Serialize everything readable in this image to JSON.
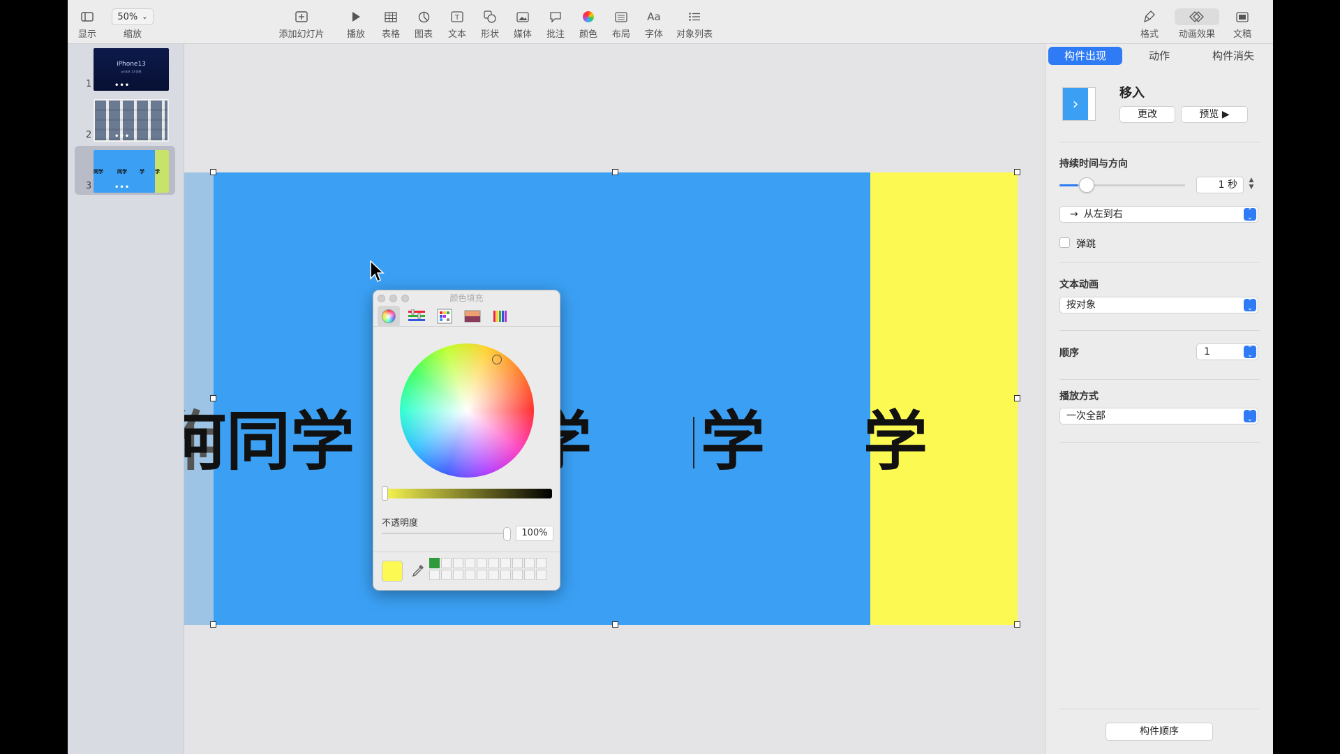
{
  "toolbar": {
    "view_label": "显示",
    "zoom_value": "50%",
    "zoom_label": "缩放",
    "add_slide_label": "添加幻灯片",
    "play_label": "播放",
    "table_label": "表格",
    "chart_label": "图表",
    "text_label": "文本",
    "shape_label": "形状",
    "media_label": "媒体",
    "comment_label": "批注",
    "color_label": "颜色",
    "layout_label": "布局",
    "font_label": "字体",
    "font_icon_text": "Aa",
    "object_list_label": "对象列表",
    "format_label": "格式",
    "animate_label": "动画效果",
    "document_label": "文稿"
  },
  "navigator": {
    "slides": [
      {
        "number": "1",
        "title": "iPhone13",
        "subtitle": "pocket 13 强悍"
      },
      {
        "number": "2"
      },
      {
        "number": "3",
        "texts": [
          "同学",
          "同学",
          "学",
          "学"
        ],
        "selected": true
      }
    ]
  },
  "slide": {
    "text_1": "何同学",
    "text_2": "何同学",
    "text_3": "学",
    "text_4": "学",
    "bg_color": "#3ba0f4",
    "rect_color": "#fbf952"
  },
  "color_panel": {
    "title": "颜色填充",
    "opacity_label": "不透明度",
    "opacity_value": "100%",
    "current_color": "#fbf952",
    "modes": [
      "color-wheel-icon",
      "sliders-icon",
      "palettes-icon",
      "image-palette-icon",
      "pencils-icon"
    ]
  },
  "inspector": {
    "tabs": [
      "构件出现",
      "动作",
      "构件消失"
    ],
    "active_tab": "构件出现",
    "effect_name": "移入",
    "change_button": "更改",
    "preview_button": "预览 ▶",
    "duration_section": "持续时间与方向",
    "duration_value": "1 秒",
    "duration_fraction": 0.15,
    "direction_value": "从左到右",
    "direction_arrow": "→",
    "bounce_label": "弹跳",
    "text_animation_section": "文本动画",
    "text_animation_value": "按对象",
    "order_section": "顺序",
    "order_value": "1",
    "delivery_section": "播放方式",
    "delivery_value": "一次全部",
    "build_order_button": "构件顺序",
    "accent_color": "#2f7bf5"
  }
}
